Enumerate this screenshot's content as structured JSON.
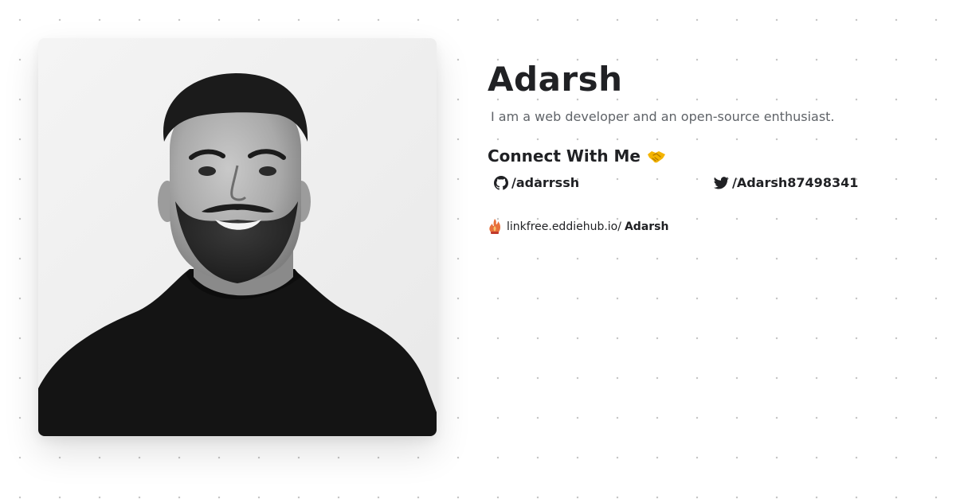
{
  "profile": {
    "name": "Adarsh",
    "bio": "I am a web developer and an open-source enthusiast."
  },
  "connect": {
    "heading": "Connect With Me",
    "hand_icon": "handshake-icon",
    "links": [
      {
        "icon": "github-icon",
        "label": "/adarrssh"
      },
      {
        "icon": "twitter-icon",
        "label": "/Adarsh87498341"
      }
    ]
  },
  "footer": {
    "logo_icon": "linkfree-logo-icon",
    "domain": "linkfree.eddiehub.io/",
    "username": "Adarsh"
  },
  "colors": {
    "text": "#202124",
    "muted": "#5f6368",
    "dots": "#c4c4c4",
    "shirt": "#141414",
    "photo_bg": "#f1f1f1"
  }
}
